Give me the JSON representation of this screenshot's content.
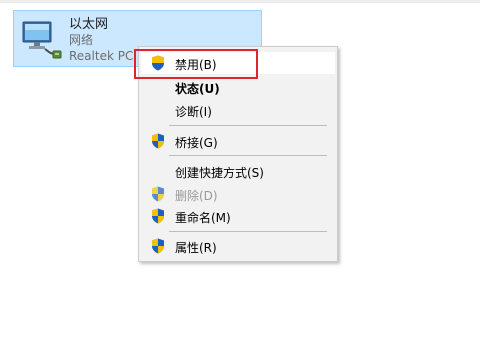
{
  "adapter": {
    "name": "以太网",
    "status": "网络",
    "device": "Realtek PC"
  },
  "context_menu": {
    "items": [
      {
        "label": "禁用(B)",
        "icon": "shield-icon",
        "state": "hover"
      },
      {
        "label": "状态(U)",
        "icon": "",
        "state": "default"
      },
      {
        "label": "诊断(I)",
        "icon": "",
        "state": "normal"
      },
      {
        "label": "桥接(G)",
        "icon": "shield-icon",
        "state": "normal"
      },
      {
        "label": "创建快捷方式(S)",
        "icon": "",
        "state": "normal"
      },
      {
        "label": "删除(D)",
        "icon": "shield-icon",
        "state": "disabled"
      },
      {
        "label": "重命名(M)",
        "icon": "shield-icon",
        "state": "normal"
      },
      {
        "label": "属性(R)",
        "icon": "shield-icon",
        "state": "normal"
      }
    ]
  },
  "colors": {
    "selection_fill": "#cce8ff",
    "selection_border": "#99d1ff",
    "menu_background": "#f2f2f2",
    "highlight_box": "#e0242b",
    "disabled_text": "#9a9a9a"
  }
}
